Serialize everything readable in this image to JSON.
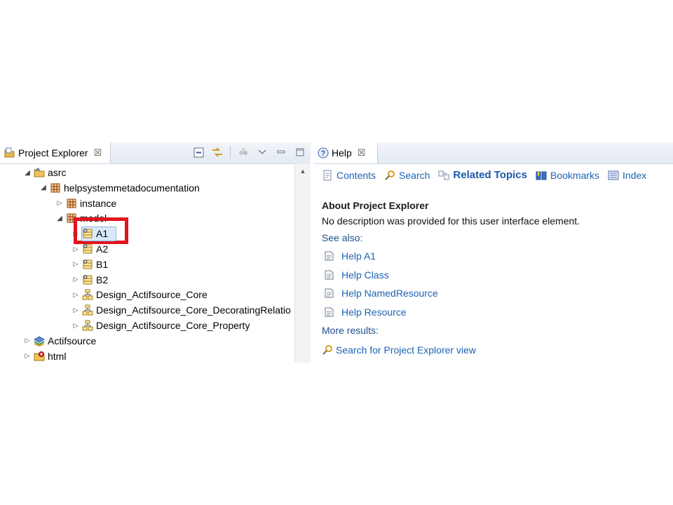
{
  "left": {
    "tab_title": "Project Explorer",
    "tab_close": "☒",
    "tree": [
      {
        "label": "asrc",
        "depth": 0,
        "twisty": "open",
        "icon": "project-folder-icon"
      },
      {
        "label": "helpsystemmetadocumentation",
        "depth": 1,
        "twisty": "open",
        "icon": "package-icon"
      },
      {
        "label": "instance",
        "depth": 2,
        "twisty": "closed",
        "icon": "package-icon"
      },
      {
        "label": "model",
        "depth": 2,
        "twisty": "open",
        "icon": "package-icon"
      },
      {
        "label": "A1",
        "depth": 3,
        "twisty": "closed",
        "icon": "class-icon",
        "selected": true
      },
      {
        "label": "A2",
        "depth": 3,
        "twisty": "closed",
        "icon": "class-icon"
      },
      {
        "label": "B1",
        "depth": 3,
        "twisty": "closed",
        "icon": "class-icon"
      },
      {
        "label": "B2",
        "depth": 3,
        "twisty": "closed",
        "icon": "class-icon"
      },
      {
        "label": "Design_Actifsource_Core",
        "depth": 3,
        "twisty": "closed",
        "icon": "diagram-icon"
      },
      {
        "label": "Design_Actifsource_Core_DecoratingRelatio",
        "depth": 3,
        "twisty": "closed",
        "icon": "diagram-icon"
      },
      {
        "label": "Design_Actifsource_Core_Property",
        "depth": 3,
        "twisty": "closed",
        "icon": "diagram-icon"
      },
      {
        "label": "Actifsource",
        "depth": 0,
        "twisty": "closed",
        "icon": "library-icon"
      },
      {
        "label": "html",
        "depth": 0,
        "twisty": "closed",
        "icon": "error-folder-icon"
      }
    ]
  },
  "right": {
    "tab_title": "Help",
    "tab_close": "☒",
    "nav": {
      "contents": "Contents",
      "search": "Search",
      "related": "Related Topics",
      "bookmarks": "Bookmarks",
      "index": "Index"
    },
    "heading": "About Project Explorer",
    "description": "No description was provided for this user interface element.",
    "see_also": "See also:",
    "links": [
      "Help A1",
      "Help Class",
      "Help NamedResource",
      "Help Resource"
    ],
    "more_results": "More results:",
    "search_link": "Search for Project Explorer view"
  },
  "colors": {
    "highlight": "#e0151e",
    "link": "#1d63b3",
    "selection": "#d9e9fb"
  }
}
